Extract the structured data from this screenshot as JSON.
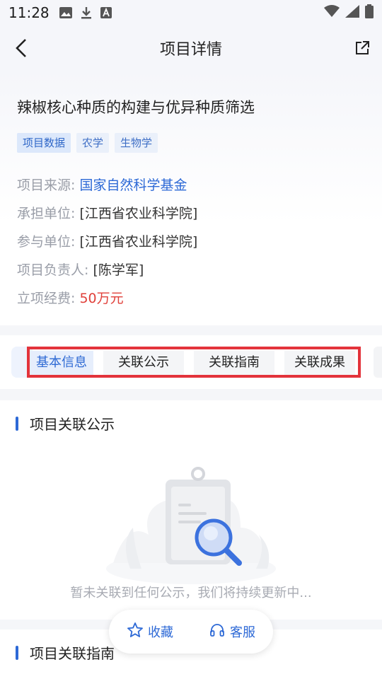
{
  "status_bar": {
    "time": "11:28"
  },
  "nav": {
    "title": "项目详情"
  },
  "project": {
    "title": "辣椒核心种质的构建与优异种质筛选",
    "tags": [
      "项目数据",
      "农学",
      "生物学"
    ],
    "info": [
      {
        "label": "项目来源: ",
        "value": "国家自然科学基金"
      },
      {
        "label": "承担单位: ",
        "value": "[江西省农业科学院]"
      },
      {
        "label": "参与单位: ",
        "value": "[江西省农业科学院]"
      },
      {
        "label": "项目负责人: ",
        "value": "[陈学军]"
      },
      {
        "label": "立项经费: ",
        "value": "50万元"
      }
    ]
  },
  "tabs": [
    "基本信息",
    "关联公示",
    "关联指南",
    "关联成果"
  ],
  "sections": {
    "related_notice": {
      "title": "项目关联公示",
      "empty_text": "暂未关联到任何公示，我们将持续更新中..."
    },
    "related_guide": {
      "title": "项目关联指南"
    }
  },
  "floating": {
    "favorite": "收藏",
    "service": "客服"
  },
  "colors": {
    "accent": "#2d69d6",
    "money": "#e0403a",
    "highlight": "#e3333b"
  }
}
